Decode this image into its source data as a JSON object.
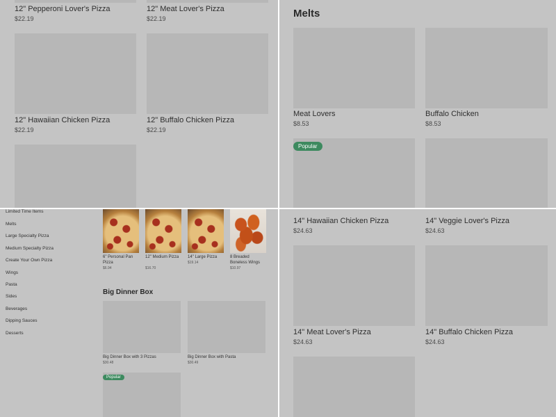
{
  "top_left": {
    "items": [
      {
        "name": "12\" Pepperoni Lover's Pizza",
        "price": "$22.19"
      },
      {
        "name": "12\" Meat Lover's Pizza",
        "price": "$22.19"
      },
      {
        "name": "12\" Hawaiian Chicken Pizza",
        "price": "$22.19"
      },
      {
        "name": "12\" Buffalo Chicken Pizza",
        "price": "$22.19"
      }
    ]
  },
  "top_right": {
    "section_title": "Melts",
    "items": [
      {
        "name": "Meat Lovers",
        "price": "$8.53"
      },
      {
        "name": "Buffalo Chicken",
        "price": "$8.53"
      }
    ],
    "popular_badge": "Popular"
  },
  "bottom_left": {
    "sidebar": [
      "Limited Time Items",
      "Melts",
      "Large Specialty Pizza",
      "Medium Specialty Pizza",
      "Create Your Own Pizza",
      "Wings",
      "Pasta",
      "Sides",
      "Beverages",
      "Dipping Sauces",
      "Desserts"
    ],
    "thumbs": [
      {
        "name": "6\" Personal Pan Pizza",
        "price": "$6.94"
      },
      {
        "name": "12\" Medium Pizza",
        "price": "$16.70"
      },
      {
        "name": "14\" Large Pizza",
        "price": "$19.14"
      },
      {
        "name": "8 Breaded Boneless Wings",
        "price": "$10.97"
      }
    ],
    "section_title": "Big Dinner Box",
    "box_items": [
      {
        "name": "Big Dinner Box with 3 Pizzas",
        "price": "$30.48"
      },
      {
        "name": "Big Dinner Box with Pasta",
        "price": "$30.49"
      }
    ],
    "popular_badge": "Popular"
  },
  "bottom_right": {
    "items": [
      {
        "name": "14\" Hawaiian Chicken Pizza",
        "price": "$24.63"
      },
      {
        "name": "14\" Veggie Lover's Pizza",
        "price": "$24.63"
      },
      {
        "name": "14\" Meat Lover's Pizza",
        "price": "$24.63"
      },
      {
        "name": "14\" Buffalo Chicken Pizza",
        "price": "$24.63"
      }
    ]
  }
}
